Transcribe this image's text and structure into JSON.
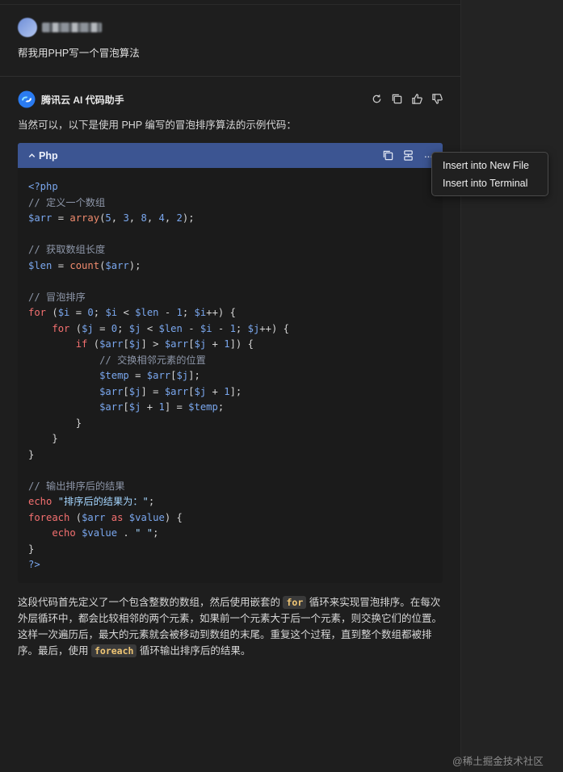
{
  "user": {
    "message": "帮我用PHP写一个冒泡算法"
  },
  "assistant": {
    "name": "腾讯云 AI 代码助手",
    "intro": "当然可以，以下是使用 PHP 编写的冒泡排序算法的示例代码：",
    "actions": [
      "refresh-icon",
      "copy-icon",
      "thumbs-up-icon",
      "thumbs-down-icon"
    ]
  },
  "code": {
    "language": "Php",
    "lines": [
      [
        [
          "tag",
          "<?php"
        ]
      ],
      [
        [
          "cm",
          "// 定义一个数组"
        ]
      ],
      [
        [
          "var",
          "$arr"
        ],
        [
          "op",
          " = "
        ],
        [
          "fn",
          "array"
        ],
        [
          "op",
          "("
        ],
        [
          "num",
          "5"
        ],
        [
          "op",
          ", "
        ],
        [
          "num",
          "3"
        ],
        [
          "op",
          ", "
        ],
        [
          "num",
          "8"
        ],
        [
          "op",
          ", "
        ],
        [
          "num",
          "4"
        ],
        [
          "op",
          ", "
        ],
        [
          "num",
          "2"
        ],
        [
          "op",
          ");"
        ]
      ],
      [],
      [
        [
          "cm",
          "// 获取数组长度"
        ]
      ],
      [
        [
          "var",
          "$len"
        ],
        [
          "op",
          " = "
        ],
        [
          "fn",
          "count"
        ],
        [
          "op",
          "("
        ],
        [
          "var",
          "$arr"
        ],
        [
          "op",
          ");"
        ]
      ],
      [],
      [
        [
          "cm",
          "// 冒泡排序"
        ]
      ],
      [
        [
          "kw",
          "for"
        ],
        [
          "op",
          " ("
        ],
        [
          "var",
          "$i"
        ],
        [
          "op",
          " = "
        ],
        [
          "num",
          "0"
        ],
        [
          "op",
          "; "
        ],
        [
          "var",
          "$i"
        ],
        [
          "op",
          " < "
        ],
        [
          "var",
          "$len"
        ],
        [
          "op",
          " - "
        ],
        [
          "num",
          "1"
        ],
        [
          "op",
          "; "
        ],
        [
          "var",
          "$i"
        ],
        [
          "op",
          "++) {"
        ]
      ],
      [
        [
          "op",
          "    "
        ],
        [
          "kw",
          "for"
        ],
        [
          "op",
          " ("
        ],
        [
          "var",
          "$j"
        ],
        [
          "op",
          " = "
        ],
        [
          "num",
          "0"
        ],
        [
          "op",
          "; "
        ],
        [
          "var",
          "$j"
        ],
        [
          "op",
          " < "
        ],
        [
          "var",
          "$len"
        ],
        [
          "op",
          " - "
        ],
        [
          "var",
          "$i"
        ],
        [
          "op",
          " - "
        ],
        [
          "num",
          "1"
        ],
        [
          "op",
          "; "
        ],
        [
          "var",
          "$j"
        ],
        [
          "op",
          "++) {"
        ]
      ],
      [
        [
          "op",
          "        "
        ],
        [
          "kw",
          "if"
        ],
        [
          "op",
          " ("
        ],
        [
          "var",
          "$arr"
        ],
        [
          "op",
          "["
        ],
        [
          "var",
          "$j"
        ],
        [
          "op",
          "] > "
        ],
        [
          "var",
          "$arr"
        ],
        [
          "op",
          "["
        ],
        [
          "var",
          "$j"
        ],
        [
          "op",
          " + "
        ],
        [
          "num",
          "1"
        ],
        [
          "op",
          "]) {"
        ]
      ],
      [
        [
          "op",
          "            "
        ],
        [
          "cm",
          "// 交换相邻元素的位置"
        ]
      ],
      [
        [
          "op",
          "            "
        ],
        [
          "var",
          "$temp"
        ],
        [
          "op",
          " = "
        ],
        [
          "var",
          "$arr"
        ],
        [
          "op",
          "["
        ],
        [
          "var",
          "$j"
        ],
        [
          "op",
          "];"
        ]
      ],
      [
        [
          "op",
          "            "
        ],
        [
          "var",
          "$arr"
        ],
        [
          "op",
          "["
        ],
        [
          "var",
          "$j"
        ],
        [
          "op",
          "] = "
        ],
        [
          "var",
          "$arr"
        ],
        [
          "op",
          "["
        ],
        [
          "var",
          "$j"
        ],
        [
          "op",
          " + "
        ],
        [
          "num",
          "1"
        ],
        [
          "op",
          "];"
        ]
      ],
      [
        [
          "op",
          "            "
        ],
        [
          "var",
          "$arr"
        ],
        [
          "op",
          "["
        ],
        [
          "var",
          "$j"
        ],
        [
          "op",
          " + "
        ],
        [
          "num",
          "1"
        ],
        [
          "op",
          "] = "
        ],
        [
          "var",
          "$temp"
        ],
        [
          "op",
          ";"
        ]
      ],
      [
        [
          "op",
          "        }"
        ]
      ],
      [
        [
          "op",
          "    }"
        ]
      ],
      [
        [
          "op",
          "}"
        ]
      ],
      [],
      [
        [
          "cm",
          "// 输出排序后的结果"
        ]
      ],
      [
        [
          "kw",
          "echo"
        ],
        [
          "op",
          " "
        ],
        [
          "str",
          "\"排序后的结果为：\""
        ],
        [
          "op",
          ";"
        ]
      ],
      [
        [
          "kw",
          "foreach"
        ],
        [
          "op",
          " ("
        ],
        [
          "var",
          "$arr"
        ],
        [
          "op",
          " "
        ],
        [
          "kw",
          "as"
        ],
        [
          "op",
          " "
        ],
        [
          "var",
          "$value"
        ],
        [
          "op",
          ") {"
        ]
      ],
      [
        [
          "op",
          "    "
        ],
        [
          "kw",
          "echo"
        ],
        [
          "op",
          " "
        ],
        [
          "var",
          "$value"
        ],
        [
          "op",
          " . "
        ],
        [
          "str",
          "\" \""
        ],
        [
          "op",
          ";"
        ]
      ],
      [
        [
          "op",
          "}"
        ]
      ],
      [
        [
          "tag",
          "?>"
        ]
      ]
    ]
  },
  "menu": {
    "items": [
      "Insert into New File",
      "Insert into Terminal"
    ]
  },
  "explanation": {
    "p1": "这段代码首先定义了一个包含整数的数组，然后使用嵌套的 ",
    "code1": "for",
    "p2": " 循环来实现冒泡排序。在每次外层循环中，都会比较相邻的两个元素，如果前一个元素大于后一个元素，则交换它们的位置。这样一次遍历后，最大的元素就会被移动到数组的末尾。重复这个过程，直到整个数组都被排序。最后，使用 ",
    "code2": "foreach",
    "p3": " 循环输出排序后的结果。"
  },
  "watermark": "@稀土掘金技术社区",
  "colors": {
    "header": "#3c5592",
    "background": "#1e1e1e",
    "keyword": "#f47070",
    "variable": "#7aa7ee"
  }
}
